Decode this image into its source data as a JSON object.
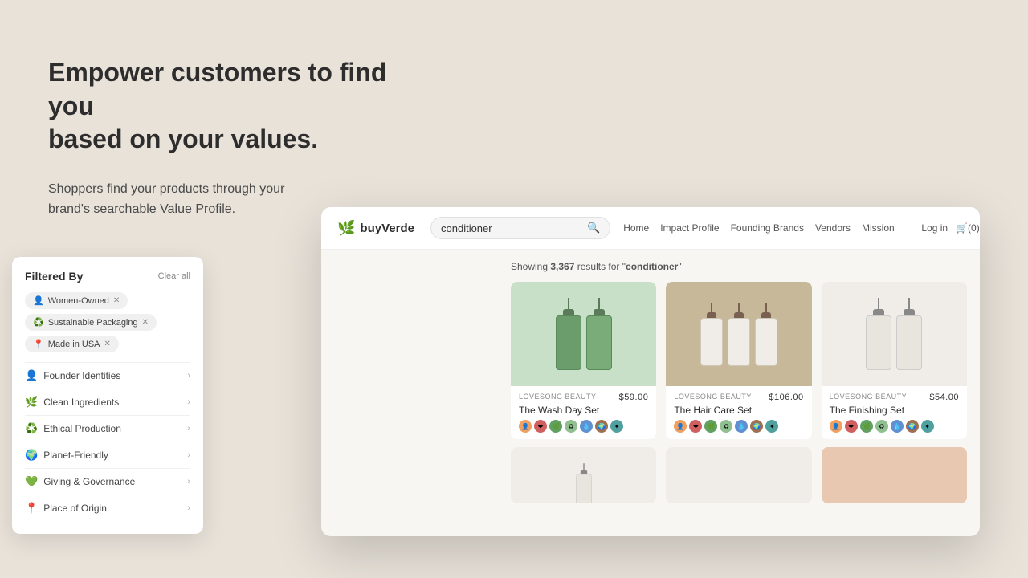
{
  "headline": "Empower customers to find you\nbased on your values.",
  "subtext": "Shoppers find your products through your\nbrand's searchable Value Profile.",
  "browser": {
    "nav": {
      "logo": "buyVerde",
      "search_placeholder": "conditioner",
      "links": [
        "Home",
        "Impact Profile",
        "Founding Brands",
        "Vendors",
        "Mission"
      ],
      "login": "Log in",
      "cart": "🛒(0)"
    },
    "filters": {
      "title": "Filtered By",
      "clear_all": "Clear all",
      "active_tags": [
        "Women-Owned",
        "Sustainable Packaging",
        "Made in USA"
      ],
      "categories": [
        {
          "icon": "👤",
          "label": "Founder Identities"
        },
        {
          "icon": "🌿",
          "label": "Clean Ingredients"
        },
        {
          "icon": "♻️",
          "label": "Ethical Production"
        },
        {
          "icon": "🌍",
          "label": "Planet-Friendly"
        },
        {
          "icon": "💚",
          "label": "Giving & Governance"
        },
        {
          "icon": "📍",
          "label": "Place of Origin"
        }
      ]
    },
    "results": {
      "count": "3,367",
      "query": "conditioner"
    },
    "products": [
      {
        "brand": "LOVESONG BEAUTY",
        "name": "The Wash Day Set",
        "price": "$59.00",
        "image_bg": "green-bg"
      },
      {
        "brand": "LOVESONG BEAUTY",
        "name": "The Hair Care Set",
        "price": "$106.00",
        "image_bg": "tan-bg"
      },
      {
        "brand": "LOVESONG BEAUTY",
        "name": "The Finishing Set",
        "price": "$54.00",
        "image_bg": "white-bg"
      }
    ]
  }
}
